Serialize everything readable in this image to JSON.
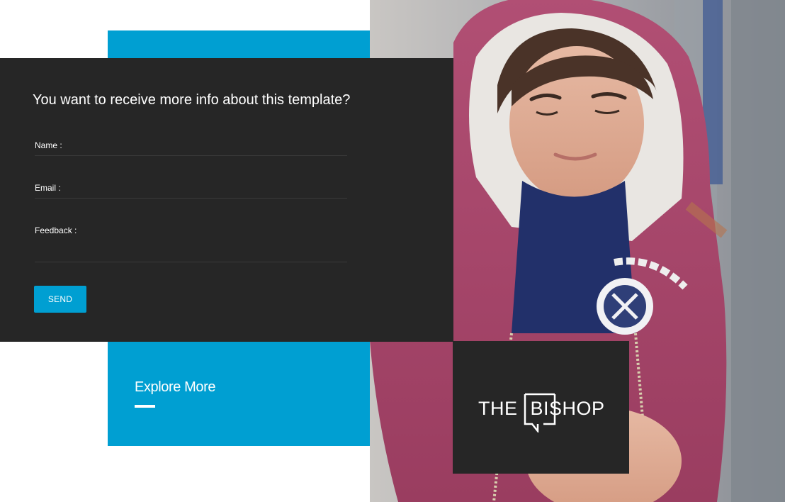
{
  "form": {
    "title": "You want to receive more info about this template?",
    "fields": {
      "name_label": "Name :",
      "email_label": "Email :",
      "feedback_label": "Feedback :"
    },
    "send_label": "SEND"
  },
  "promo": {
    "explore_label": "Explore More"
  },
  "logo": {
    "word1": "THE",
    "word2": "BISHOP"
  },
  "colors": {
    "accent": "#009fd2",
    "dark_panel": "#262626",
    "photo_hoodie": "#a9446a"
  }
}
